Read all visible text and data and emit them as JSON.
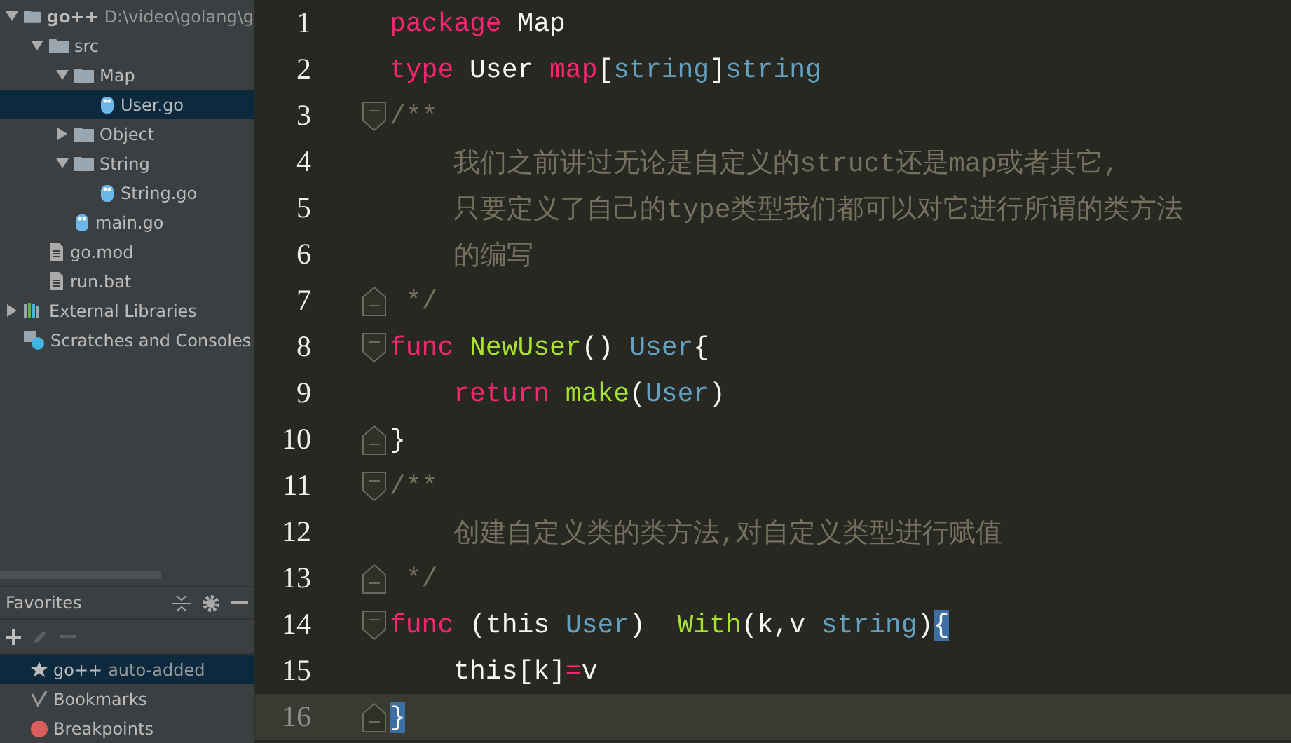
{
  "project_tree": [
    {
      "label": "go++",
      "hint": "D:\\video\\golang\\g",
      "kind": "folder",
      "expanded": true,
      "selected": false,
      "children": [
        {
          "label": "src",
          "kind": "folder",
          "expanded": true,
          "selected": false,
          "children": [
            {
              "label": "Map",
              "kind": "folder",
              "expanded": true,
              "selected": false,
              "children": [
                {
                  "label": "User.go",
                  "kind": "go",
                  "selected": true
                }
              ]
            },
            {
              "label": "Object",
              "kind": "folder",
              "expanded": false,
              "selected": false
            },
            {
              "label": "String",
              "kind": "folder",
              "expanded": true,
              "selected": false,
              "children": [
                {
                  "label": "String.go",
                  "kind": "go",
                  "selected": false
                }
              ]
            },
            {
              "label": "main.go",
              "kind": "go",
              "selected": false
            }
          ]
        },
        {
          "label": "go.mod",
          "kind": "file",
          "selected": false
        },
        {
          "label": "run.bat",
          "kind": "file",
          "selected": false
        }
      ]
    },
    {
      "label": "External Libraries",
      "kind": "libraries",
      "expanded": false,
      "selected": false
    },
    {
      "label": "Scratches and Consoles",
      "kind": "scratches",
      "selected": false
    }
  ],
  "favorites": {
    "title": "Favorites",
    "items": [
      {
        "label": "go++",
        "hint": "auto-added",
        "kind": "star",
        "selected": true
      },
      {
        "label": "Bookmarks",
        "kind": "check",
        "selected": false
      },
      {
        "label": "Breakpoints",
        "kind": "dot",
        "color": "#db5c5c",
        "selected": false
      }
    ]
  },
  "editor": {
    "lines": [
      {
        "number": "1",
        "kind": "plain",
        "current": false,
        "tokens": [
          {
            "kind": "kw",
            "text": "package"
          },
          {
            "kind": "plain",
            "text": " Map"
          }
        ]
      },
      {
        "number": "2",
        "kind": "plain",
        "current": false,
        "tokens": [
          {
            "kind": "kw",
            "text": "type"
          },
          {
            "kind": "plain",
            "text": " User "
          },
          {
            "kind": "kw",
            "text": "map"
          },
          {
            "kind": "plain",
            "text": "["
          },
          {
            "kind": "type",
            "text": "string"
          },
          {
            "kind": "plain",
            "text": "]"
          },
          {
            "kind": "type",
            "text": "string"
          }
        ]
      },
      {
        "number": "3",
        "kind": "fold_start",
        "current": false,
        "tokens": [
          {
            "kind": "comment",
            "text": "/**"
          }
        ]
      },
      {
        "number": "4",
        "kind": "plain",
        "current": false,
        "tokens": [
          {
            "kind": "comment",
            "text": "    我们之前讲过无论是自定义的struct还是map或者其它,"
          }
        ]
      },
      {
        "number": "5",
        "kind": "plain",
        "current": false,
        "tokens": [
          {
            "kind": "comment",
            "text": "    只要定义了自己的type类型我们都可以对它进行所谓的类方法"
          }
        ]
      },
      {
        "number": "6",
        "kind": "plain",
        "current": false,
        "tokens": [
          {
            "kind": "comment",
            "text": "    的编写"
          }
        ]
      },
      {
        "number": "7",
        "kind": "fold_end",
        "current": false,
        "tokens": [
          {
            "kind": "comment",
            "text": " */"
          }
        ]
      },
      {
        "number": "8",
        "kind": "fold_start",
        "current": false,
        "tokens": [
          {
            "kind": "kw",
            "text": "func "
          },
          {
            "kind": "fn",
            "text": "NewUser"
          },
          {
            "kind": "plain",
            "text": "() "
          },
          {
            "kind": "type",
            "text": "User"
          },
          {
            "kind": "plain",
            "text": "{"
          }
        ]
      },
      {
        "number": "9",
        "kind": "plain",
        "current": false,
        "tokens": [
          {
            "kind": "kw",
            "text": "    return "
          },
          {
            "kind": "fn",
            "text": "make"
          },
          {
            "kind": "plain",
            "text": "("
          },
          {
            "kind": "type",
            "text": "User"
          },
          {
            "kind": "plain",
            "text": ")"
          }
        ]
      },
      {
        "number": "10",
        "kind": "fold_end",
        "current": false,
        "tokens": [
          {
            "kind": "plain",
            "text": "}"
          }
        ]
      },
      {
        "number": "11",
        "kind": "fold_start",
        "current": false,
        "tokens": [
          {
            "kind": "comment",
            "text": "/**"
          }
        ]
      },
      {
        "number": "12",
        "kind": "plain",
        "current": false,
        "tokens": [
          {
            "kind": "comment",
            "text": "    创建自定义类的类方法,对自定义类型进行赋值"
          }
        ]
      },
      {
        "number": "13",
        "kind": "fold_end",
        "current": false,
        "tokens": [
          {
            "kind": "comment",
            "text": " */"
          }
        ]
      },
      {
        "number": "14",
        "kind": "fold_start",
        "current": false,
        "tokens": [
          {
            "kind": "kw",
            "text": "func"
          },
          {
            "kind": "plain",
            "text": " (this "
          },
          {
            "kind": "type",
            "text": "User"
          },
          {
            "kind": "plain",
            "text": ")  "
          },
          {
            "kind": "fn",
            "text": "With"
          },
          {
            "kind": "plain",
            "text": "(k,v "
          },
          {
            "kind": "type",
            "text": "string"
          },
          {
            "kind": "plain",
            "text": ")"
          },
          {
            "kind": "match",
            "text": "{"
          }
        ]
      },
      {
        "number": "15",
        "kind": "plain",
        "current": false,
        "tokens": [
          {
            "kind": "plain",
            "text": "    this[k]"
          },
          {
            "kind": "kw",
            "text": "="
          },
          {
            "kind": "plain",
            "text": "v"
          }
        ]
      },
      {
        "number": "16",
        "kind": "fold_end",
        "current": true,
        "tokens": [
          {
            "kind": "match",
            "text": "}"
          }
        ]
      }
    ]
  }
}
